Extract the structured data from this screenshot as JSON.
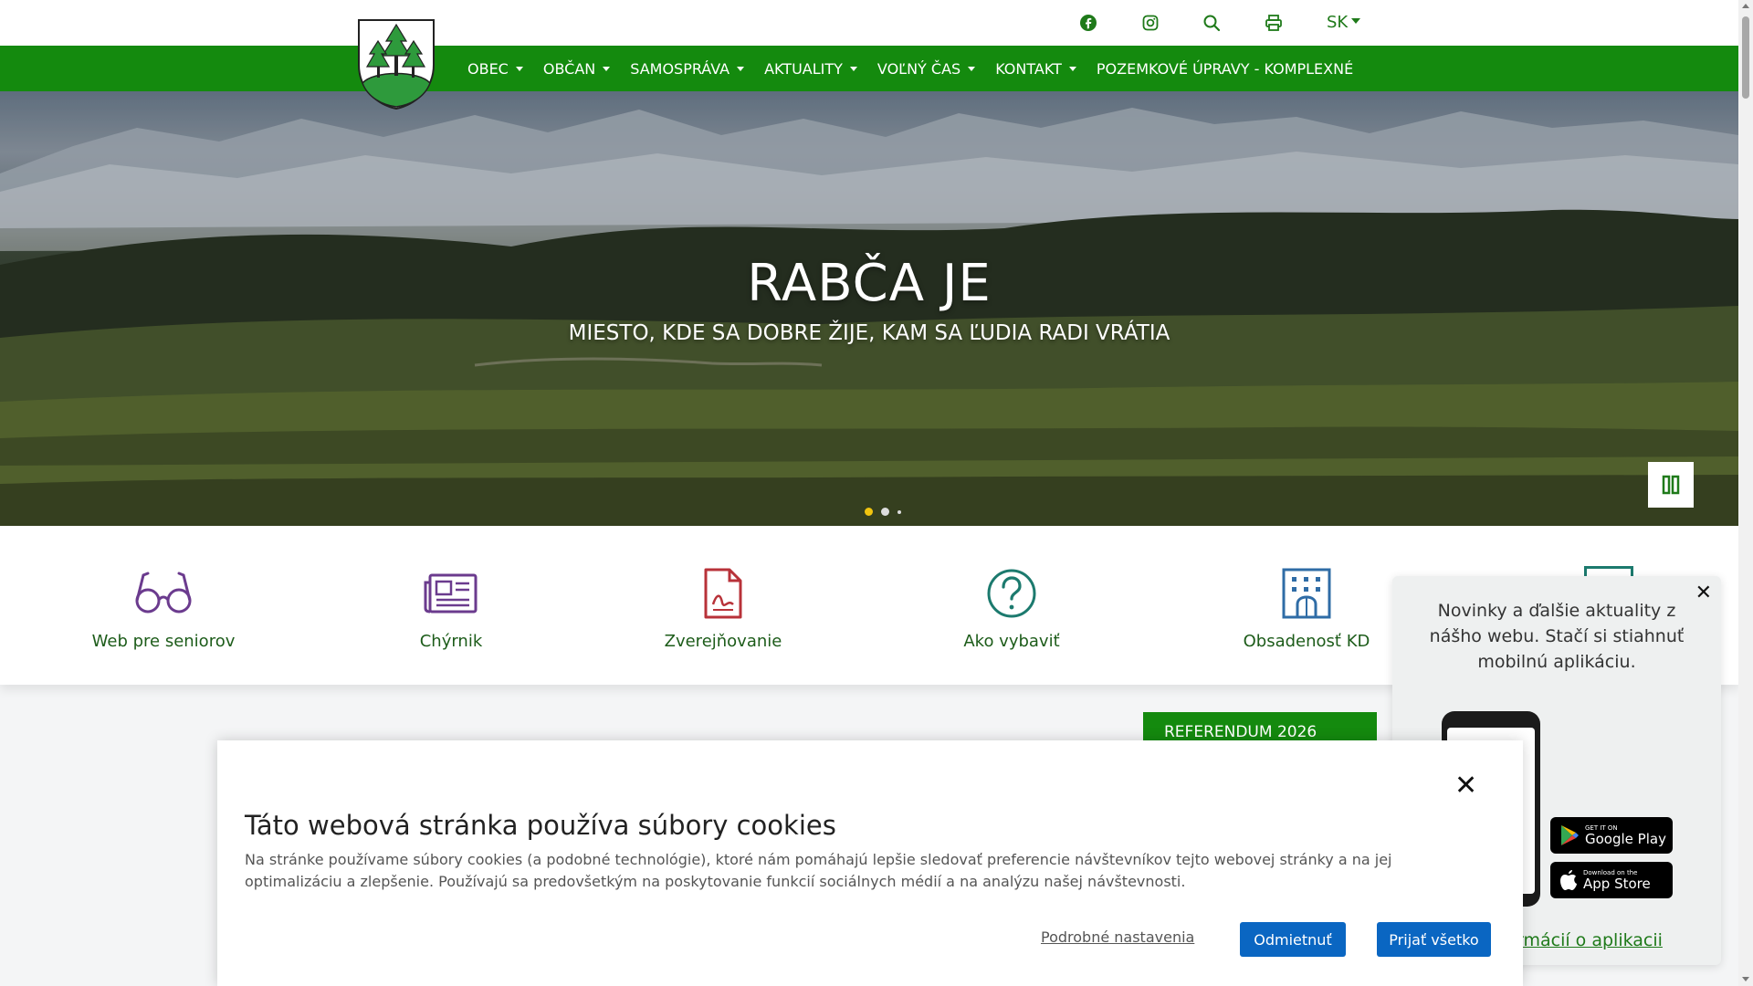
{
  "topbar": {
    "icons": [
      "facebook-icon",
      "instagram-icon",
      "search-icon",
      "print-icon"
    ],
    "lang": "SK"
  },
  "nav": {
    "items": [
      {
        "label": "OBEC",
        "dropdown": true
      },
      {
        "label": "OBČAN",
        "dropdown": true
      },
      {
        "label": "SAMOSPRÁVA",
        "dropdown": true
      },
      {
        "label": "AKTUALITY",
        "dropdown": true
      },
      {
        "label": "VOĽNÝ ČAS",
        "dropdown": true
      },
      {
        "label": "KONTAKT",
        "dropdown": true
      },
      {
        "label": "POZEMKOVÉ ÚPRAVY - KOMPLEXNÉ",
        "dropdown": false
      }
    ]
  },
  "hero": {
    "title": "RABČA JE",
    "subtitle": "MIESTO, KDE SA DOBRE ŽIJE, KAM SA ĽUDIA RADI VRÁTIA",
    "slide_count": 3,
    "active_slide": 1
  },
  "quick_links": [
    {
      "label": "Web pre seniorov",
      "icon": "glasses-icon"
    },
    {
      "label": "Chýrnik",
      "icon": "newspaper-icon"
    },
    {
      "label": "Zverejňovanie",
      "icon": "document-icon"
    },
    {
      "label": "Ako vybaviť",
      "icon": "question-icon"
    },
    {
      "label": "Obsadenosť KD",
      "icon": "building-icon"
    }
  ],
  "sidebar_button": "REFERENDUM 2026",
  "app_popup": {
    "text": "Novinky a ďalšie aktuality z nášho webu. Stačí si stiahnuť mobilnú aplikáciu.",
    "google_small": "GET IT ON",
    "google_big": "Google Play",
    "apple_small": "Download on the",
    "apple_big": "App Store",
    "link": "rmácií o aplikacii"
  },
  "cookie": {
    "title": "Táto webová stránka používa súbory cookies",
    "body": "Na stránke používame súbory cookies (a podobné technológie), ktoré nám pomáhajú lepšie sledovať preferencie návštevníkov tejto webovej stránky a na jej optimalizáciu a zlepšenie. Používajú sa predovšetkým na poskytovanie funkcií sociálnych médií a na analýzu našej návštevnosti.",
    "settings": "Podrobné nastavenia",
    "reject": "Odmietnuť",
    "accept": "Prijať všetko"
  },
  "colors": {
    "brand_green": "#148a0e",
    "link_green": "#1f7a1a",
    "purple_icon": "#6b3b8e",
    "red_icon": "#b83239",
    "teal_icon": "#1c7a6e",
    "blue_icon": "#2f6ca6",
    "button_blue": "#0a66c2"
  }
}
